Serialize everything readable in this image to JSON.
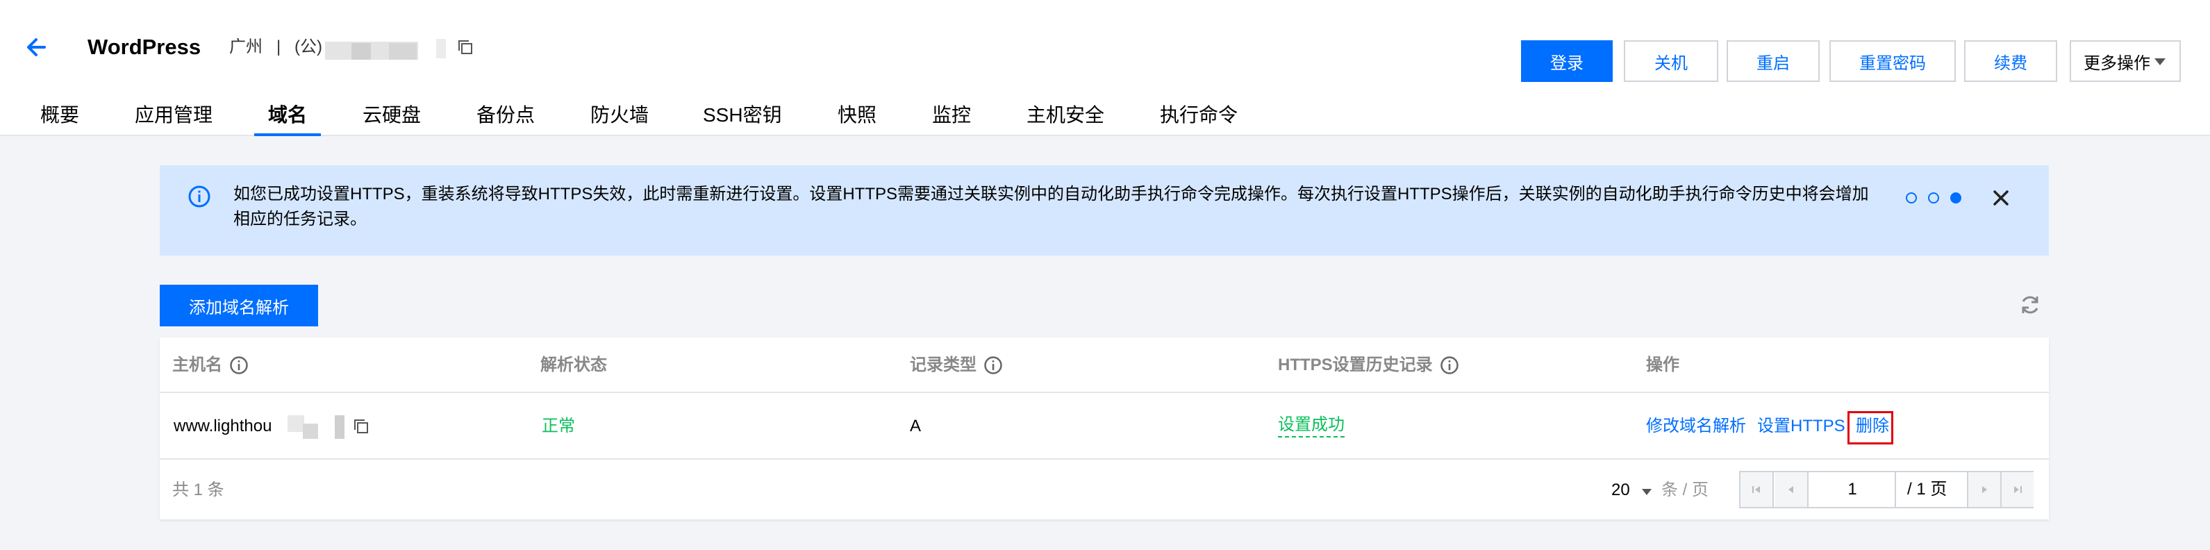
{
  "header": {
    "title": "WordPress",
    "region": "广州",
    "separator": "|",
    "ip_type": "(公)",
    "actions": {
      "login": "登录",
      "shutdown": "关机",
      "restart": "重启",
      "reset_password": "重置密码",
      "renew": "续费",
      "more": "更多操作"
    }
  },
  "tabs": [
    "概要",
    "应用管理",
    "域名",
    "云硬盘",
    "备份点",
    "防火墙",
    "SSH密钥",
    "快照",
    "监控",
    "主机安全",
    "执行命令"
  ],
  "active_tab": "域名",
  "notice": {
    "text": "如您已成功设置HTTPS，重装系统将导致HTTPS失效，此时需重新进行设置。设置HTTPS需要通过关联实例中的自动化助手执行命令完成操作。每次执行设置HTTPS操作后，关联实例的自动化助手执行命令历史中将会增加相应的任务记录。",
    "pages": 3,
    "active_page": 3
  },
  "toolbar": {
    "add_button": "添加域名解析"
  },
  "table": {
    "columns": [
      "主机名",
      "解析状态",
      "记录类型",
      "HTTPS设置历史记录",
      "操作"
    ],
    "rows": [
      {
        "host": "www.lighthou",
        "status": "正常",
        "record_type": "A",
        "https_history": "设置成功",
        "ops": {
          "edit": "修改域名解析",
          "https": "设置HTTPS",
          "delete": "删除"
        }
      }
    ]
  },
  "pagination": {
    "total": "共 1 条",
    "page_size": "20",
    "page_size_unit": "条 / 页",
    "current_page": "1",
    "total_pages": "/ 1 页"
  },
  "colors": {
    "primary": "#006eff",
    "success": "#0abf5b",
    "notice_bg": "#d5e7ff",
    "highlight": "#e0000a"
  }
}
